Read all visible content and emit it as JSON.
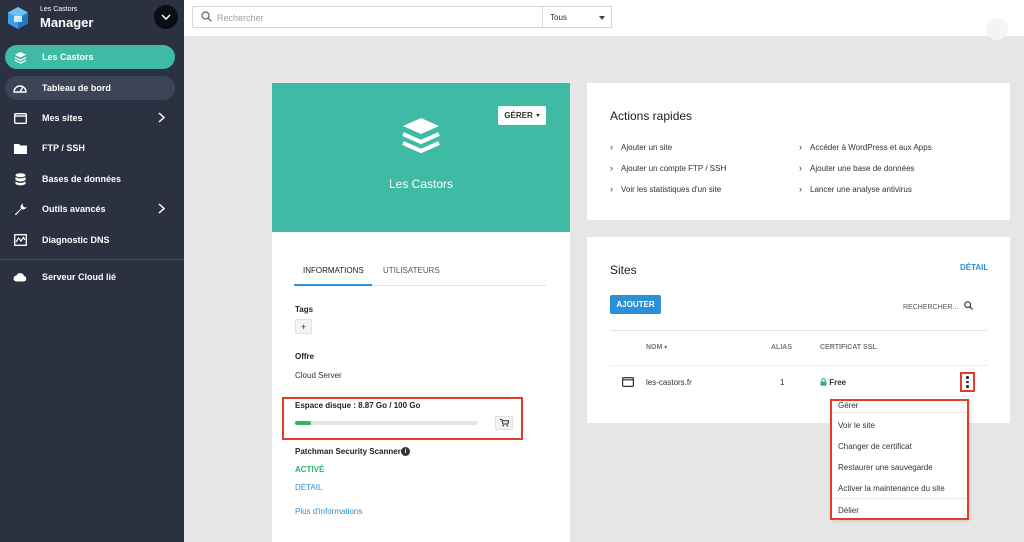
{
  "brand": {
    "small": "Les Castors",
    "big": "Manager"
  },
  "sidebar": {
    "items": [
      {
        "label": "Les Castors",
        "icon": "layers-icon"
      },
      {
        "label": "Tableau de bord",
        "icon": "dashboard-icon"
      },
      {
        "label": "Mes sites",
        "icon": "monitor-icon"
      },
      {
        "label": "FTP / SSH",
        "icon": "folder-icon"
      },
      {
        "label": "Bases de données",
        "icon": "database-icon"
      },
      {
        "label": "Outils avancés",
        "icon": "wrench-icon"
      },
      {
        "label": "Diagnostic DNS",
        "icon": "dns-icon"
      },
      {
        "label": "Serveur Cloud lié",
        "icon": "cloud-icon"
      }
    ]
  },
  "topbar": {
    "search_placeholder": "Rechercher",
    "filter_value": "Tous"
  },
  "server": {
    "name": "Les Castors",
    "manage_label": "GÉRER",
    "tabs": [
      "INFORMATIONS",
      "UTILISATEURS"
    ],
    "tags_label": "Tags",
    "tag_add": "+",
    "offer_label": "Offre",
    "offer_value": "Cloud Server",
    "disk_label": "Espace disque : 8.87 Go / 100 Go",
    "disk_usage_fraction": 0.0887,
    "scanner_label": "Patchman Security Scanner",
    "scanner_status": "ACTIVÉ",
    "scanner_detail": "DÉTAIL",
    "more_info": "Plus d'informations"
  },
  "actions": {
    "title": "Actions rapides",
    "left": [
      "Ajouter un site",
      "Ajouter un compte FTP / SSH",
      "Voir les statistiques d'un site"
    ],
    "right": [
      "Accéder à WordPress et aux Apps",
      "Ajouter une base de données",
      "Lancer une analyse antivirus"
    ]
  },
  "sites": {
    "title": "Sites",
    "detail_link": "DÉTAIL",
    "add_button": "AJOUTER",
    "search_label": "RECHERCHER...",
    "columns": {
      "name": "NOM",
      "alias": "ALIAS",
      "ssl": "CERTIFICAT SSL"
    },
    "rows": [
      {
        "name": "les-castors.fr",
        "alias": "1",
        "ssl": "Free"
      }
    ]
  },
  "menu": {
    "items": [
      "Gérer",
      "Voir le site",
      "Changer de certificat",
      "Restaurer une sauvegarde",
      "Activer la maintenance du site",
      "Délier"
    ]
  },
  "colors": {
    "teal": "#3ebaa5",
    "sidebar": "#2b3140",
    "blue": "#2d8fd6",
    "green": "#2fb26a",
    "highlight": "#e03e2d"
  }
}
